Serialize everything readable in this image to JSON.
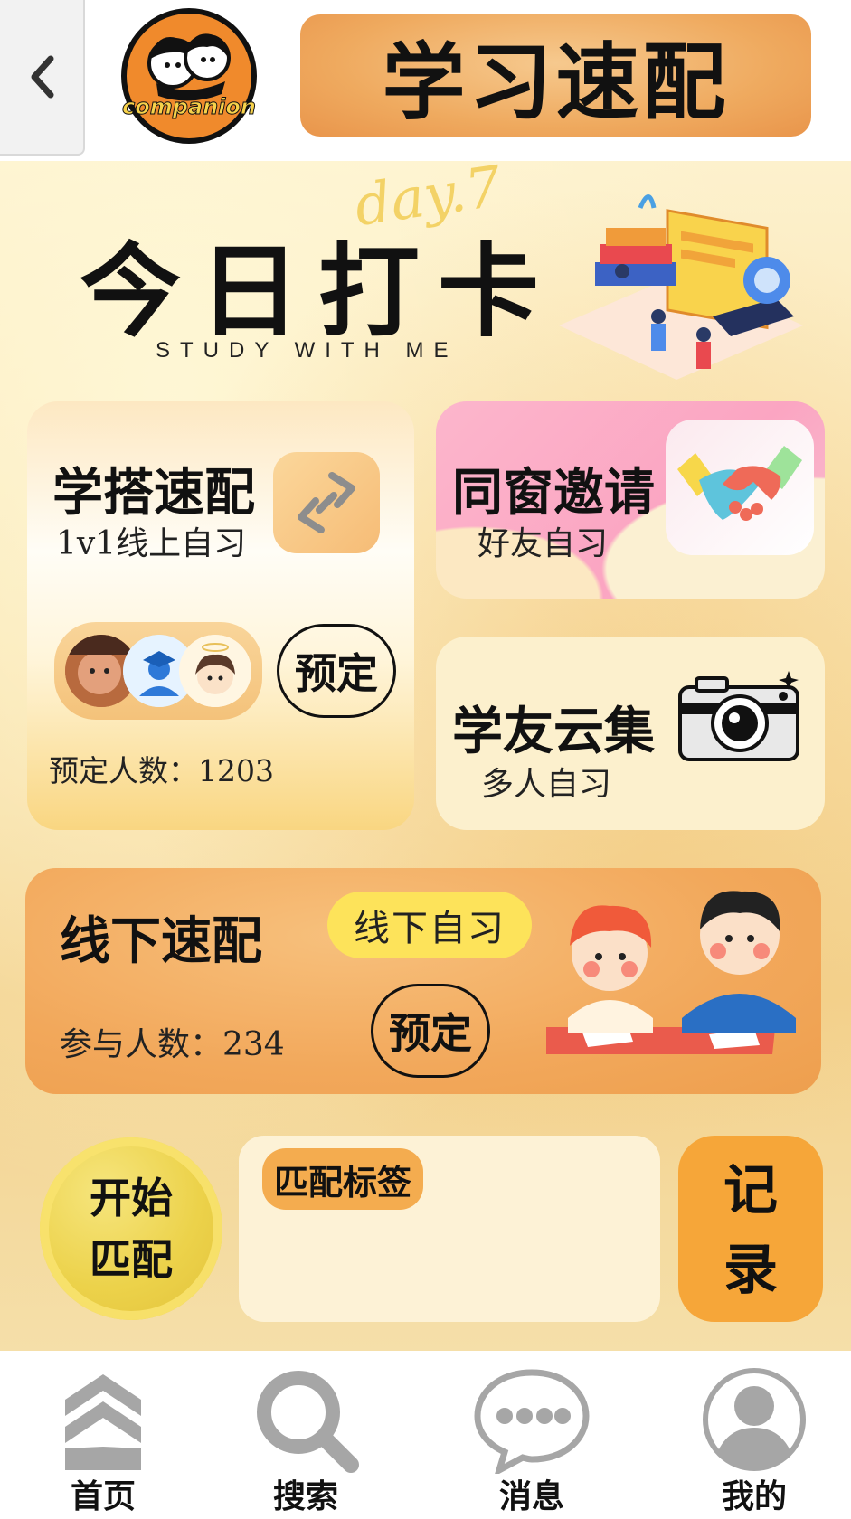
{
  "header": {
    "back_icon": "chevron-left-icon",
    "logo_text": "companion",
    "title": "学习速配"
  },
  "checkin": {
    "day_label": "day.7",
    "title": "今日打卡",
    "subtitle": "STUDY WITH ME"
  },
  "cards": {
    "xueda": {
      "title": "学搭速配",
      "subtitle": "1v1线上自习",
      "icon": "link-icon",
      "reserve_label": "预定",
      "reserve_count": "预定人数：1203"
    },
    "tongchuang": {
      "title": "同窗邀请",
      "subtitle": "好友自习",
      "icon": "handshake-icon"
    },
    "xueyou": {
      "title": "学友云集",
      "subtitle": "多人自习",
      "icon": "camera-icon"
    },
    "xianxia": {
      "title": "线下速配",
      "tag": "线下自习",
      "reserve_label": "预定",
      "participate_count": "参与人数：234"
    }
  },
  "actions": {
    "start_line1": "开始",
    "start_line2": "匹配",
    "tags_label": "匹配标签",
    "records_line1": "记",
    "records_line2": "录"
  },
  "nav": {
    "items": [
      {
        "label": "首页",
        "icon": "home-chevrons-icon"
      },
      {
        "label": "搜索",
        "icon": "search-icon"
      },
      {
        "label": "消息",
        "icon": "message-icon"
      },
      {
        "label": "我的",
        "icon": "profile-icon"
      }
    ]
  },
  "colors": {
    "banner_orange": "#efaa5f",
    "card_pink": "#fba5c2",
    "tag_yellow": "#fde35a",
    "records_orange": "#f6a639",
    "start_yellow": "#ecd24a",
    "nav_icon_gray": "#a6a6a6"
  }
}
